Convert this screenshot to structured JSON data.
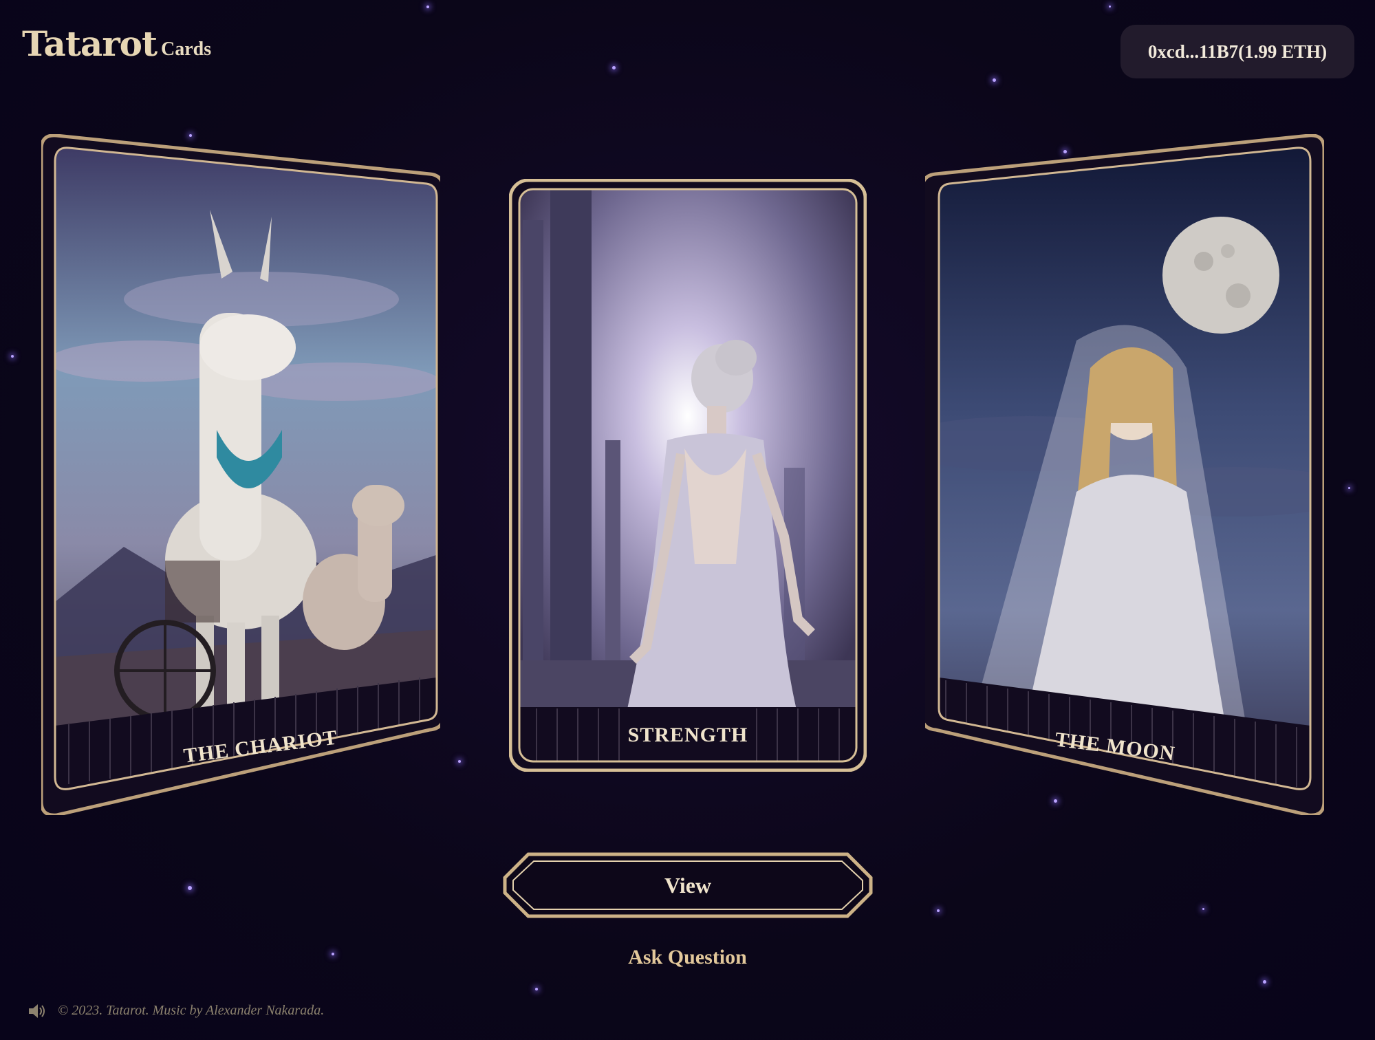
{
  "header": {
    "logo": "Tatarot",
    "nav_cards": "Cards",
    "wallet": "0xcd...11B7(1.99 ETH)"
  },
  "cards": [
    {
      "title": "THE CHARIOT"
    },
    {
      "title": "STRENGTH"
    },
    {
      "title": "THE MOON"
    }
  ],
  "actions": {
    "view": "View",
    "ask": "Ask Question"
  },
  "footer": {
    "icon": "speaker-icon",
    "text": "© 2023. Tatarot. Music by Alexander Nakarada."
  },
  "colors": {
    "background": "#0b0618",
    "gold": "#c9ac83",
    "text": "#f0e4cc",
    "star": "#b9a3ff"
  }
}
